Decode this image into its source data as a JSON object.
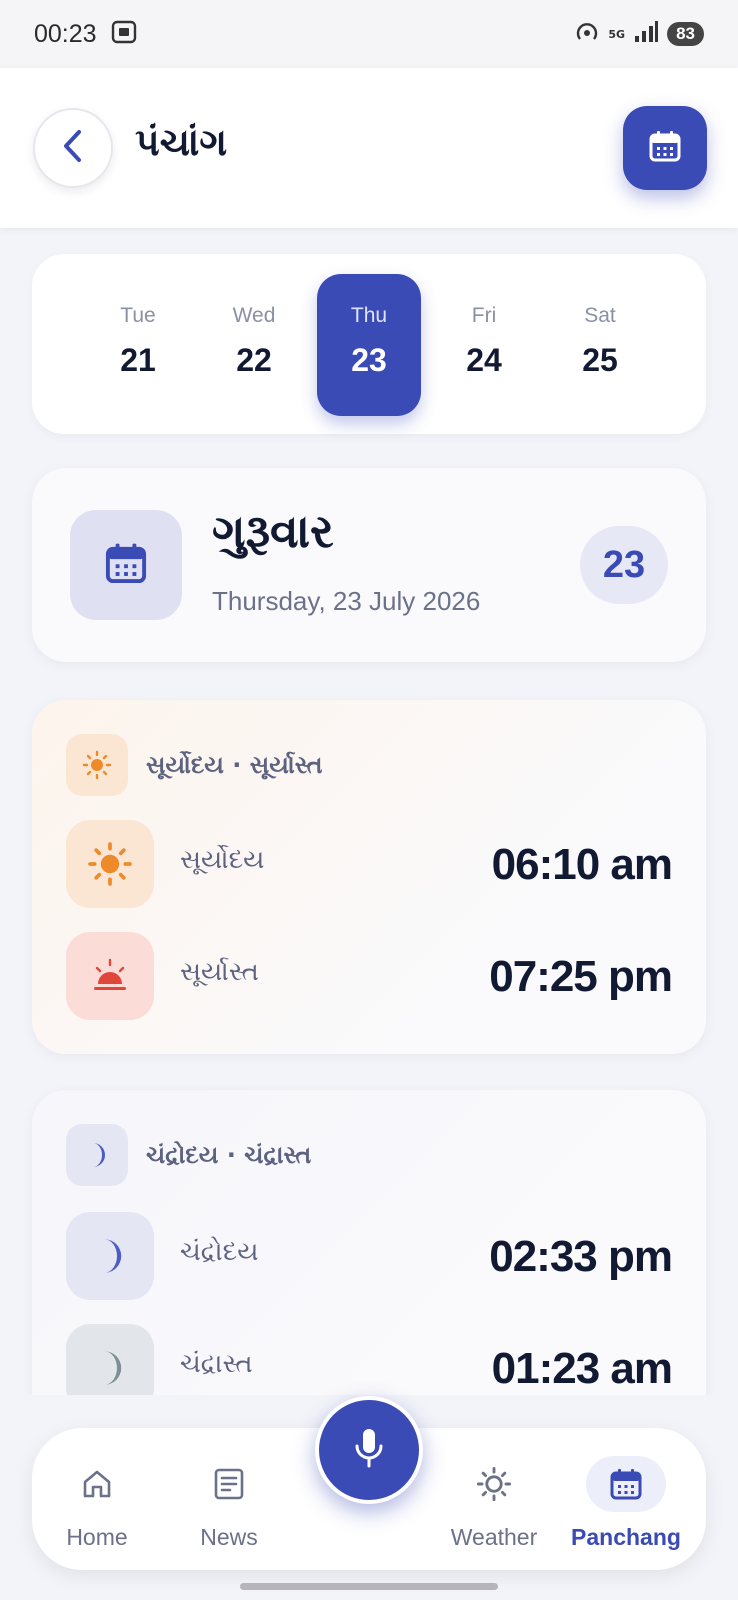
{
  "status_bar": {
    "time": "00:23",
    "network": "5G",
    "battery": "83"
  },
  "header": {
    "title": "પંચાંગ",
    "back_icon": "chevron-left-icon",
    "calendar_icon": "calendar-icon"
  },
  "date_strip": {
    "days": [
      {
        "name": "Tue",
        "num": "21"
      },
      {
        "name": "Wed",
        "num": "22"
      },
      {
        "name": "Thu",
        "num": "23"
      },
      {
        "name": "Fri",
        "num": "24"
      },
      {
        "name": "Sat",
        "num": "25"
      }
    ],
    "selected_index": 2
  },
  "day_card": {
    "gujarati_day": "ગુરૂવાર",
    "english_date": "Thursday, 23 July 2026",
    "badge": "23"
  },
  "sun": {
    "title": "સૂર્યોદય · સૂર્યાસ્ત",
    "rise_label": "સૂર્યોદય",
    "rise_time": "06:10 am",
    "set_label": "સૂર્યાસ્ત",
    "set_time": "07:25 pm"
  },
  "moon": {
    "title": "ચંદ્રોદય · ચંદ્રાસ્ત",
    "rise_label": "ચંદ્રોદય",
    "rise_time": "02:33 pm",
    "set_label": "ચંદ્રાસ્ત",
    "set_time": "01:23 am"
  },
  "nav": {
    "items": [
      {
        "label": "Home",
        "icon": "home-icon"
      },
      {
        "label": "News",
        "icon": "news-icon"
      },
      {
        "label": "Weather",
        "icon": "sun-icon"
      },
      {
        "label": "Panchang",
        "icon": "calendar-icon"
      }
    ],
    "active": "Panchang"
  },
  "colors": {
    "accent": "#3b4bb5",
    "sun_orange": "#ee8a2a",
    "sunset_red": "#e0473b",
    "moon_blue": "#4b5cc4",
    "moon_gray": "#7b8f94"
  }
}
